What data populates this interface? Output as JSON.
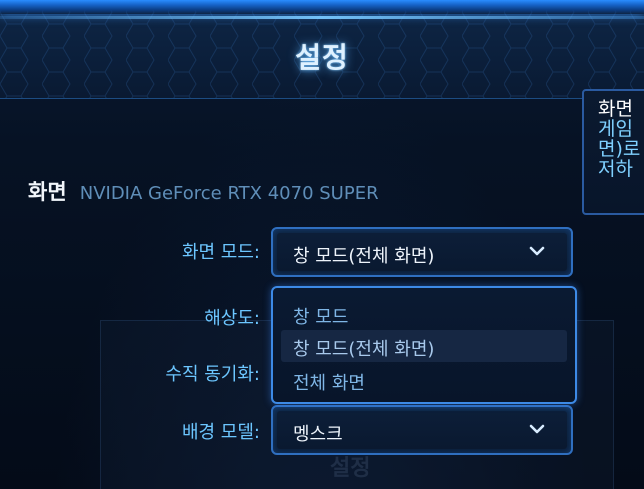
{
  "header": {
    "title": "설정"
  },
  "tooltip": {
    "title": "화면",
    "lines": [
      "게임",
      "면)로",
      "저하"
    ]
  },
  "display": {
    "section_label": "화면",
    "gpu_name": "NVIDIA GeForce RTX 4070 SUPER"
  },
  "settings": {
    "screen_mode": {
      "label": "화면 모드:",
      "value": "창 모드(전체 화면)"
    },
    "resolution": {
      "label": "해상도:"
    },
    "vsync": {
      "label": "수직 동기화:"
    },
    "background_model": {
      "label": "배경 모델:",
      "value": "멩스크"
    }
  },
  "dropdown": {
    "options": [
      "창 모드",
      "창 모드(전체 화면)",
      "전체 화면"
    ],
    "selected_index": 1
  },
  "icons": {
    "chevron": "chevron-down-icon"
  },
  "colors": {
    "accent": "#3d8ae6",
    "label": "#6cc6ff",
    "title_glow": "#5ab4ff"
  }
}
